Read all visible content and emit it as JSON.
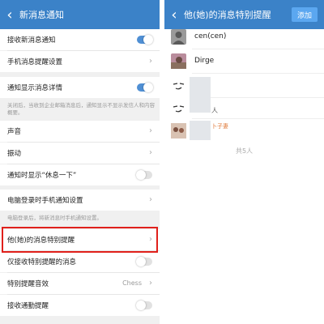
{
  "left": {
    "header": {
      "back_icon": "chevron-left",
      "title": "新消息通知",
      "background": "#3b82c8"
    },
    "rows": [
      {
        "label": "接收新消息通知",
        "control": "toggle",
        "toggle_on": true
      },
      {
        "label": "手机消息提醒设置",
        "control": "chevron"
      },
      {
        "label": "通知显示消息详情",
        "control": "toggle",
        "toggle_on": true
      },
      {
        "label": "声音",
        "control": "chevron"
      },
      {
        "label": "振动",
        "control": "chevron"
      },
      {
        "label": "通知时显示“休息一下”",
        "control": "toggle",
        "toggle_on": false
      },
      {
        "label": "电脑登录时手机通知设置",
        "control": "chevron"
      },
      {
        "label": "他(她)的消息特别提醒",
        "control": "chevron",
        "highlighted": true
      },
      {
        "label": "仅接收特别提醒的消息",
        "control": "toggle",
        "toggle_on": false
      },
      {
        "label": "特别提醒音效",
        "control": "value-chevron",
        "value": "Chess"
      },
      {
        "label": "接收通勤提醒",
        "control": "toggle",
        "toggle_on": false
      }
    ],
    "notes": {
      "details": "关闭后，当收到企业邮箱消息后，通知显示不显示发信人和内容概要。",
      "pc_login": "电脑登录后，将新消息时手机通知设置。"
    },
    "highlight_color": "#e0201b"
  },
  "right": {
    "header": {
      "back_icon": "chevron-left",
      "title": "他(她)的消息特别提醒",
      "add_label": "添加"
    },
    "contacts": [
      {
        "name": "cen(cen)",
        "avatar_color": "#9a9a9a"
      },
      {
        "name": "Dirge",
        "avatar_color": "#b98c9c"
      },
      {
        "name": ""
      },
      {
        "name": "",
        "blur_text": "人"
      },
      {
        "name": "",
        "blur_text": "卜子妻"
      }
    ],
    "footer": "共5人"
  }
}
